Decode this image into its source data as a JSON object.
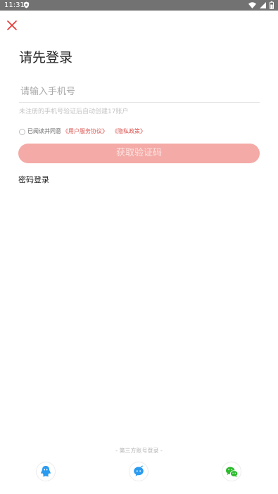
{
  "status_bar": {
    "time": "11:31"
  },
  "page": {
    "title": "请先登录",
    "phone_placeholder": "请输入手机号",
    "hint": "未注册的手机号验证后自动创建17账户",
    "agreement": {
      "prefix": "已阅读并同意",
      "user_agreement": "《用户服务协议》",
      "privacy_policy": "《隐私政策》"
    },
    "get_code_button": "获取验证码",
    "password_login": "密码登录"
  },
  "third_party": {
    "label": "- 第三方账号登录 -",
    "icons": [
      "qq-icon",
      "chat-bubble-icon",
      "wechat-icon"
    ]
  },
  "colors": {
    "accent": "#e53935",
    "button_bg": "#f4aaa6",
    "link": "#d9534f",
    "qq": "#2a9bf0",
    "wechat": "#2dbb2d"
  }
}
